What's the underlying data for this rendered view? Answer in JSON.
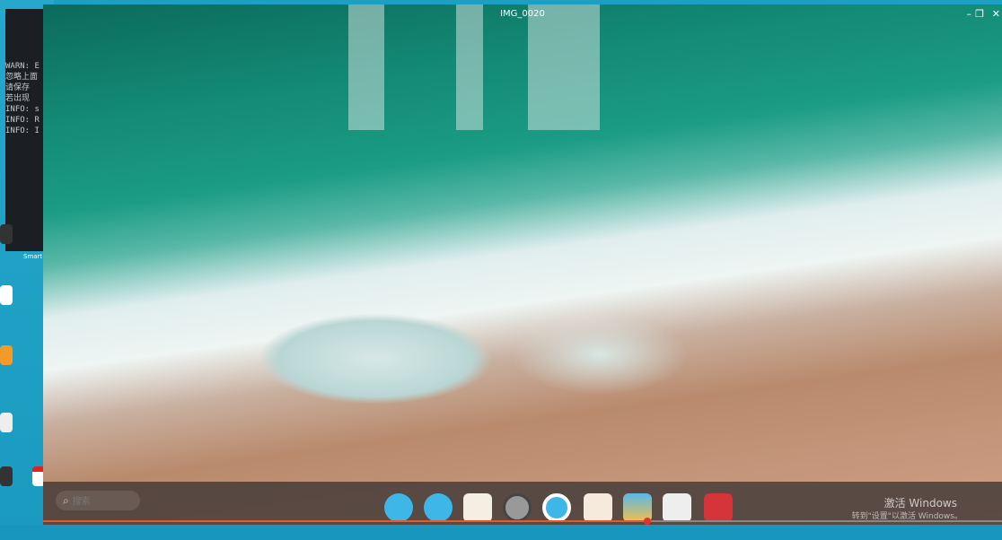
{
  "window": {
    "title": "IMG_0020",
    "controls": [
      "minimize",
      "restore",
      "close"
    ]
  },
  "terminal": {
    "lines": [
      "WARN: E",
      "忽略上面",
      "请保存",
      "若出现",
      "INFO: s",
      "INFO: R",
      "INFO: I"
    ]
  },
  "desktop": {
    "labels": [
      "Smart TN"
    ]
  },
  "dock": {
    "search_placeholder": "搜索",
    "apps": [
      "launcher",
      "multitask",
      "calendar",
      "browser",
      "cloud",
      "notes",
      "photos",
      "files",
      "app-store"
    ]
  },
  "video": {
    "progress_percent": 63
  },
  "watermark": {
    "line1": "激活 Windows",
    "line2": "转到\"设置\"以激活 Windows。"
  },
  "colors": {
    "accent": "#e55a2b",
    "dock_blue": "#3fb6e8",
    "desktop": "#1d9fc4"
  }
}
